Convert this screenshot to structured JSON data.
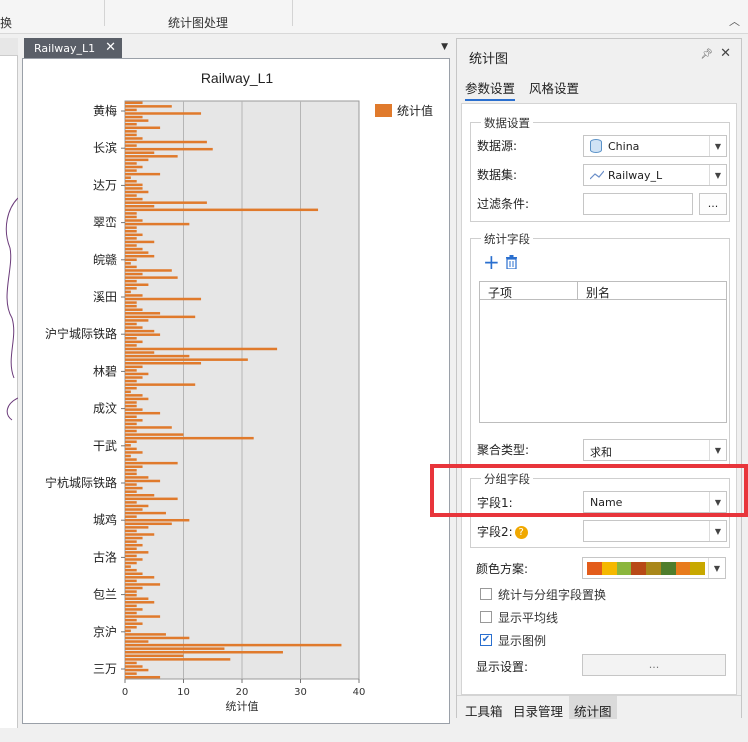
{
  "ribbon": {
    "left_fragment": "换",
    "group_label": "统计图处理"
  },
  "document": {
    "tab_label": "Railway_L1"
  },
  "panel": {
    "title": "统计图",
    "tabs": [
      "参数设置",
      "风格设置"
    ],
    "data_settings": {
      "group_title": "数据设置",
      "source_label": "数据源:",
      "source_value": "China",
      "dataset_label": "数据集:",
      "dataset_value": "Railway_L",
      "filter_label": "过滤条件:",
      "filter_value": "",
      "filter_button": "..."
    },
    "stat_fields": {
      "group_title": "统计字段",
      "columns": [
        "子项",
        "别名"
      ],
      "rows": [],
      "aggregate_label": "聚合类型:",
      "aggregate_value": "求和"
    },
    "group_fields": {
      "group_title": "分组字段",
      "field1_label": "字段1:",
      "field1_value": "Name",
      "field2_label": "字段2:",
      "field2_value": ""
    },
    "color_scheme_label": "颜色方案:",
    "color_scheme": [
      "#e35c1a",
      "#f5b800",
      "#8bb63d",
      "#b84a17",
      "#a9871a",
      "#4f7d2c",
      "#e87b1c",
      "#c8a800"
    ],
    "options": [
      {
        "label": "统计与分组字段置换",
        "checked": false
      },
      {
        "label": "显示平均线",
        "checked": false
      },
      {
        "label": "显示图例",
        "checked": true
      }
    ],
    "display_settings_label": "显示设置:",
    "display_settings_button": "...",
    "bottom_tabs": [
      "工具箱",
      "目录管理",
      "统计图"
    ],
    "active_bottom_tab": "统计图"
  },
  "chart_data": {
    "type": "bar",
    "orientation": "horizontal",
    "title": "Railway_L1",
    "xlabel": "统计值",
    "ylabel": "",
    "xlim": [
      0,
      40
    ],
    "xticks": [
      0,
      10,
      20,
      30,
      40
    ],
    "grid": true,
    "legend": {
      "position": "top-right",
      "entries": [
        "统计值"
      ]
    },
    "bar_color": "#e07a2c",
    "category_tick_labels": [
      "黄梅",
      "长滨",
      "达万",
      "翠峦",
      "皖赣",
      "溪田",
      "沪宁城际铁路",
      "林碧",
      "成汶",
      "干武",
      "宁杭城际铁路",
      "城鸡",
      "古洛",
      "包兰",
      "京沪",
      "三万"
    ],
    "series": [
      {
        "name": "统计值",
        "values": [
          3,
          8,
          2,
          13,
          3,
          4,
          2,
          6,
          2,
          2,
          3,
          14,
          2,
          15,
          5,
          9,
          4,
          2,
          3,
          2,
          6,
          1,
          2,
          3,
          3,
          4,
          2,
          3,
          14,
          5,
          33,
          2,
          2,
          3,
          11,
          2,
          2,
          3,
          2,
          5,
          2,
          3,
          4,
          5,
          2,
          1,
          2,
          8,
          3,
          9,
          2,
          4,
          2,
          1,
          3,
          13,
          2,
          2,
          3,
          6,
          12,
          4,
          2,
          3,
          5,
          6,
          2,
          3,
          2,
          26,
          5,
          11,
          21,
          13,
          3,
          2,
          4,
          3,
          2,
          12,
          2,
          1,
          3,
          4,
          2,
          2,
          3,
          6,
          2,
          3,
          2,
          8,
          2,
          10,
          22,
          2,
          1,
          2,
          3,
          1,
          2,
          9,
          3,
          2,
          2,
          4,
          6,
          2,
          3,
          2,
          5,
          9,
          2,
          4,
          3,
          7,
          2,
          11,
          8,
          4,
          2,
          5,
          3,
          2,
          3,
          2,
          4,
          2,
          3,
          2,
          1,
          2,
          3,
          5,
          2,
          6,
          3,
          2,
          2,
          4,
          5,
          2,
          3,
          2,
          6,
          2,
          3,
          2,
          1,
          7,
          11,
          4,
          37,
          17,
          27,
          10,
          18,
          2,
          3,
          4,
          2,
          6
        ]
      }
    ]
  }
}
